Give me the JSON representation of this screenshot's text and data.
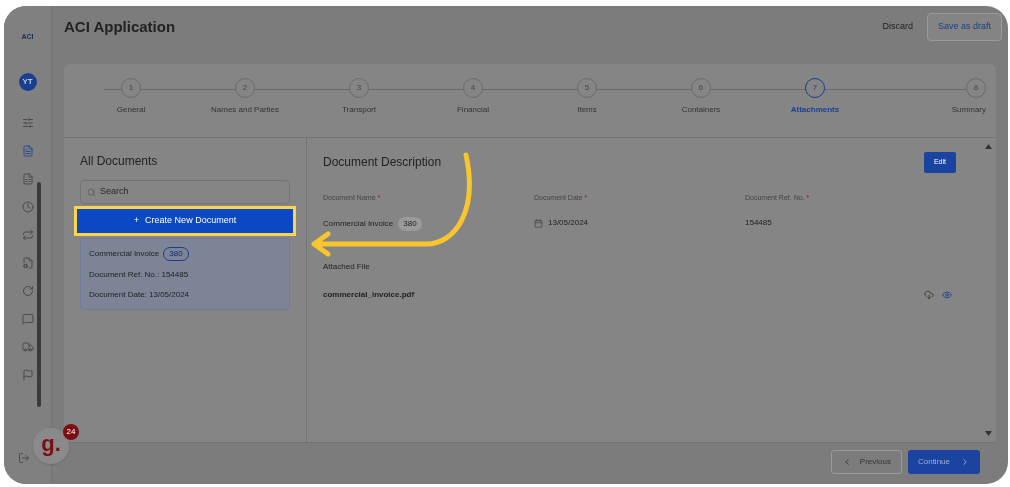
{
  "sidebar": {
    "logo": "ACI",
    "avatar": "YT"
  },
  "header": {
    "title": "ACI Application",
    "discard": "Discard",
    "save": "Save as draft"
  },
  "steps": [
    {
      "number": "1",
      "label": "General",
      "selected": false
    },
    {
      "number": "2",
      "label": "Names and Parties",
      "selected": false
    },
    {
      "number": "3",
      "label": "Transport",
      "selected": false
    },
    {
      "number": "4",
      "label": "Financial",
      "selected": false
    },
    {
      "number": "5",
      "label": "Items",
      "selected": false
    },
    {
      "number": "6",
      "label": "Containers",
      "selected": false
    },
    {
      "number": "7",
      "label": "Attachments",
      "selected": true
    },
    {
      "number": "8",
      "label": "Summary",
      "selected": false
    }
  ],
  "documents": {
    "title": "All Documents",
    "search_placeholder": "Search",
    "create": "Create New Document",
    "create_symbol": "+",
    "items": [
      {
        "name": "Commercial Invoice",
        "code": "380",
        "ref": "Document Ref. No.: 154485",
        "date": "Document Date: 13/05/2024",
        "selected": true
      }
    ]
  },
  "detail": {
    "title": "Document Description",
    "edit": "Edit",
    "fields": [
      {
        "label": "Document Name",
        "required": "*",
        "value": "Commercial Invoice",
        "code": "380",
        "kind": "name"
      },
      {
        "label": "Document Date",
        "required": "*",
        "value": "13/05/2024",
        "kind": "date"
      },
      {
        "label": "Document Ref. No.",
        "required": "*",
        "value": "154485",
        "kind": "text"
      }
    ],
    "attached_label": "Attached File",
    "file": "commercial_invoice.pdf"
  },
  "footer": {
    "previous": "Previous",
    "continue": "Continue"
  },
  "widget": {
    "letter": "g.",
    "count": "24"
  }
}
